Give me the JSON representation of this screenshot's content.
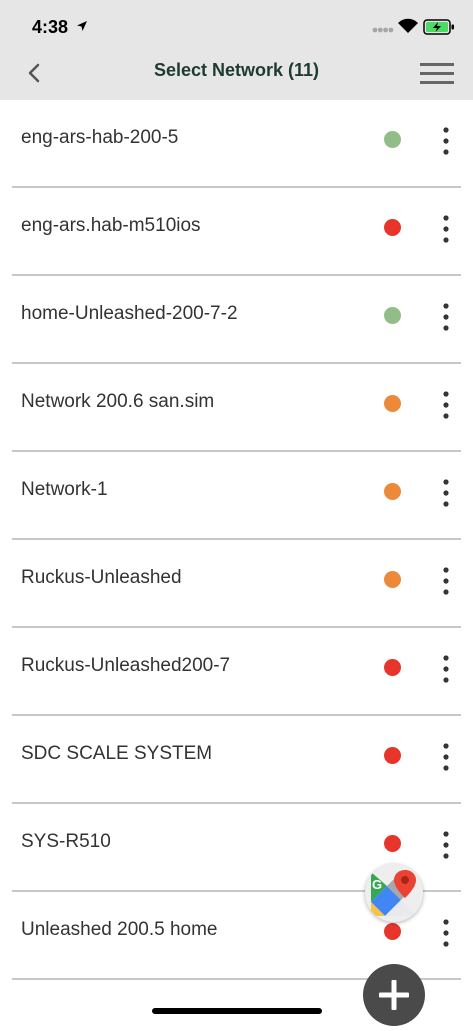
{
  "status_bar": {
    "time": "4:38"
  },
  "header": {
    "title": "Select Network (11)"
  },
  "colors": {
    "green": "#93bd86",
    "red": "#e8352b",
    "orange": "#ec8a3a"
  },
  "networks": [
    {
      "name": "eng-ars-hab-200-5",
      "status": "green"
    },
    {
      "name": "eng-ars.hab-m510ios",
      "status": "red"
    },
    {
      "name": "home-Unleashed-200-7-2",
      "status": "green"
    },
    {
      "name": "Network 200.6 san.sim",
      "status": "orange"
    },
    {
      "name": "Network-1",
      "status": "orange"
    },
    {
      "name": "Ruckus-Unleashed",
      "status": "orange"
    },
    {
      "name": "Ruckus-Unleashed200-7",
      "status": "red"
    },
    {
      "name": "SDC SCALE SYSTEM",
      "status": "red"
    },
    {
      "name": "SYS-R510",
      "status": "red"
    },
    {
      "name": "Unleashed 200.5 home",
      "status": "red"
    }
  ],
  "icons": {
    "location": "location-arrow-icon",
    "wifi": "wifi-icon",
    "battery": "battery-charging-icon",
    "back": "chevron-left-icon",
    "menu": "hamburger-menu-icon",
    "more": "more-vertical-icon",
    "maps": "google-maps-icon",
    "add": "plus-icon"
  }
}
